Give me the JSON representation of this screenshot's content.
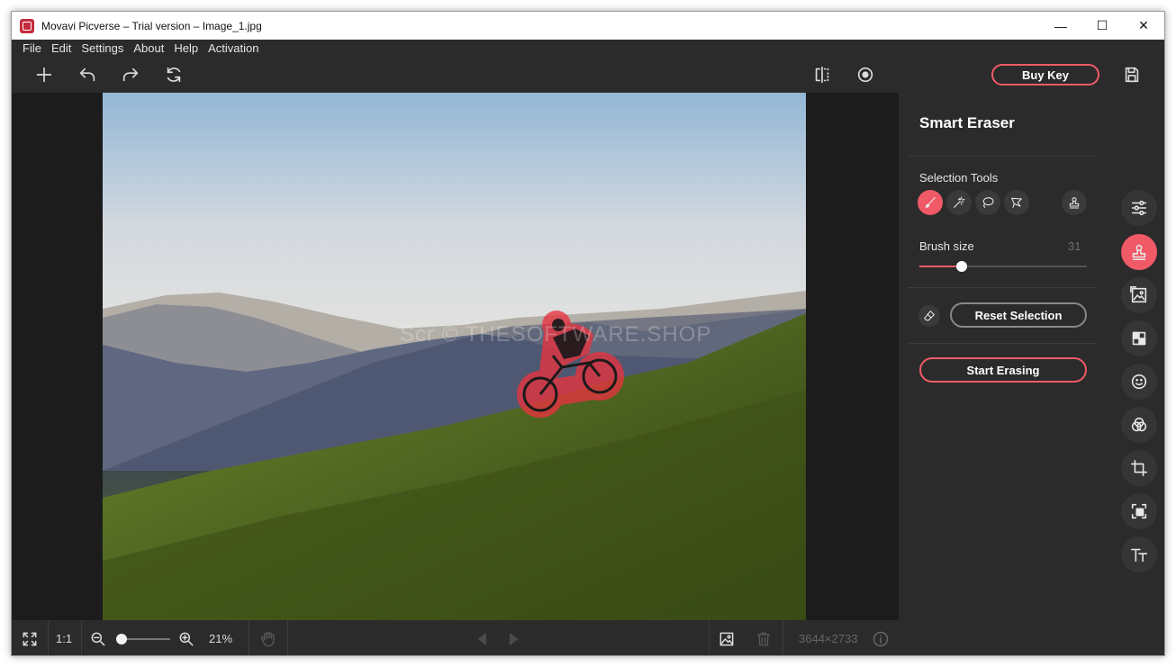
{
  "window": {
    "title": "Movavi Picverse – Trial version – Image_1.jpg",
    "controls": {
      "minimize": "—",
      "maximize": "☐",
      "close": "✕"
    }
  },
  "menu": {
    "items": [
      "File",
      "Edit",
      "Settings",
      "About",
      "Help",
      "Activation"
    ]
  },
  "toolbar": {
    "buy_key_label": "Buy Key",
    "icons": [
      "plus-icon",
      "undo-icon",
      "redo-icon",
      "reset-icon",
      "compare-icon",
      "eye-icon",
      "save-icon"
    ]
  },
  "canvas": {
    "watermark": "Scr © THESOFTWARE.SHOP"
  },
  "bottombar": {
    "actual_size_label": "1:1",
    "zoom_percent": "21%",
    "zoom_level": 0.21,
    "image_dimensions": "3644×2733"
  },
  "panel": {
    "title": "Smart Eraser",
    "selection_tools_label": "Selection Tools",
    "selection_tools": [
      "brush-icon",
      "magic-wand-icon",
      "lasso-icon",
      "polygon-lasso-icon",
      "stamp-icon"
    ],
    "brush_size_label": "Brush size",
    "brush_size_value": "31",
    "brush_size_fraction": 0.25,
    "reset_selection_label": "Reset Selection",
    "start_erasing_label": "Start Erasing"
  },
  "side_tools": [
    "adjust-icon",
    "eraser-stamp-icon",
    "replace-background-icon",
    "pattern-icon",
    "face-icon",
    "effects-icon",
    "crop-icon",
    "select-icon",
    "text-icon"
  ],
  "colors": {
    "accent": "#f05a67",
    "background": "#2b2b2b",
    "canvas": "#1c1c1c"
  }
}
